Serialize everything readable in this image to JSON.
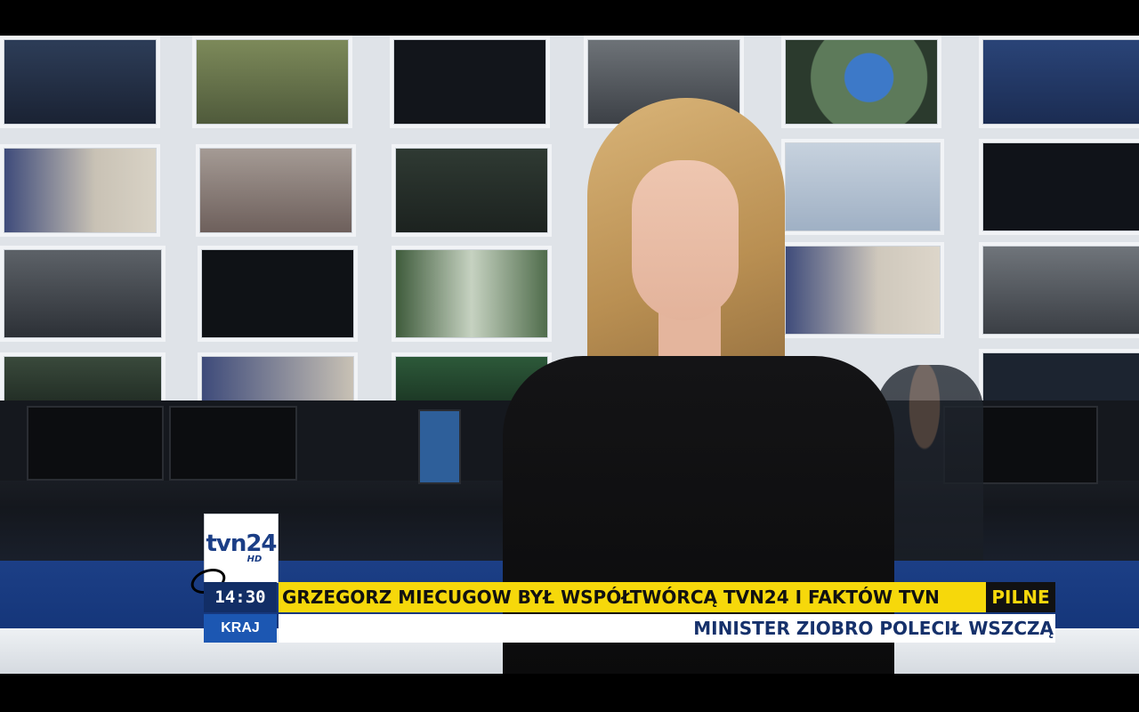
{
  "broadcast": {
    "channel_logo": "tvn24",
    "logo_suffix": "HD",
    "time": "14:30",
    "section": "KRAJ",
    "headline": "GRZEGORZ MIECUGOW BYŁ WSPÓŁTWÓRCĄ TVN24 I FAKTÓW TVN",
    "urgent_label": "PILNE",
    "ticker": "MINISTER ZIOBRO POLECIŁ WSZCZĄ"
  },
  "colors": {
    "headline_yellow": "#f6d80b",
    "brand_blue": "#1b3e86",
    "time_bg": "#122e66",
    "section_bg": "#1c57b2"
  }
}
